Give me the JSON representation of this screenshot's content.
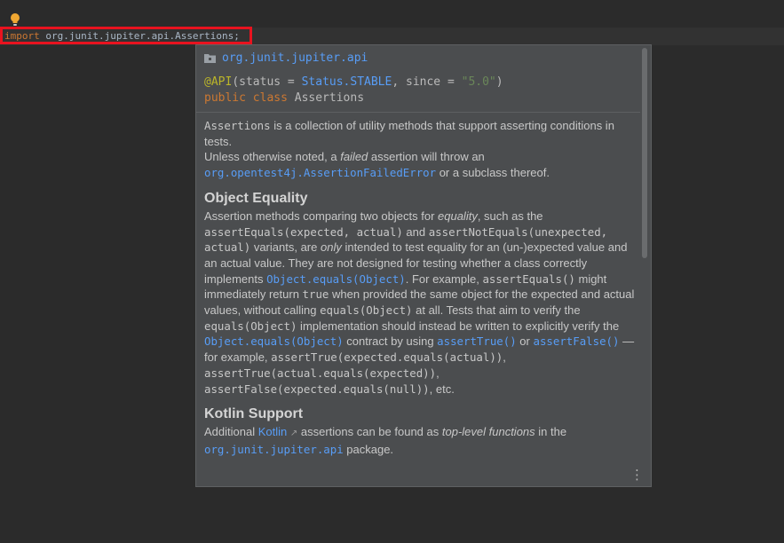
{
  "editor": {
    "import_keyword": "import",
    "import_path": " org.junit.jupiter.api.Assertions",
    "import_semicolon": ";"
  },
  "popup": {
    "package_link": "org.junit.jupiter.api",
    "signature": {
      "annotation": "@API",
      "args_open": "(status = ",
      "status_value": "Status.STABLE",
      "since_part": ", since = ",
      "since_value": "\"5.0\"",
      "args_close": ")",
      "modifiers": "public class ",
      "class_name": "Assertions"
    },
    "intro": {
      "class_code": "Assertions",
      "text1": " is a collection of utility methods that support asserting conditions in tests.",
      "text2": "Unless otherwise noted, a ",
      "failed": "failed",
      "text3": " assertion will throw an ",
      "error_link": "org.opentest4j.AssertionFailedError",
      "text4": " or a subclass thereof."
    },
    "equality": {
      "heading": "Object Equality",
      "t1": "Assertion methods comparing two objects for ",
      "equality": "equality",
      "t2": ", such as the ",
      "c1": "assertEquals(expected, actual)",
      "t3": " and ",
      "c2": "assertNotEquals(unexpected, actual)",
      "t4": " variants, are ",
      "only": "only",
      "t5": " intended to test equality for an (un-)expected value and an actual value. They are not designed for testing whether a class correctly implements ",
      "l1": "Object.equals(Object)",
      "t6": ". For example, ",
      "c3": "assertEquals()",
      "t7": " might immediately return ",
      "c4": "true",
      "t8": " when provided the same object for the expected and actual values, without calling ",
      "c5": "equals(Object)",
      "t9": " at all. Tests that aim to verify the ",
      "c6": "equals(Object)",
      "t10": " implementation should instead be written to explicitly verify the ",
      "l2": "Object.equals(Object)",
      "t11": " contract by using ",
      "l3": "assertTrue()",
      "t12": " or ",
      "l4": "assertFalse()",
      "t13": " — for example, ",
      "c7": "assertTrue(expected.equals(actual))",
      "t14": ", ",
      "c8": "assertTrue(actual.equals(expected))",
      "t15": ", ",
      "c9": "assertFalse(expected.equals(null))",
      "t16": ", etc."
    },
    "kotlin": {
      "heading": "Kotlin Support",
      "t1": "Additional ",
      "kotlin_link": "Kotlin",
      "ext": "↗",
      "t2": " assertions can be found as ",
      "top_level": "top-level functions",
      "t3": " in the ",
      "pkg_link": "org.junit.jupiter.api",
      "t4": " package."
    },
    "more_icon": "vertical-ellipsis",
    "colors": {
      "background": "#2b2b2b",
      "popup_bg": "#4b4d4f",
      "link": "#589df6",
      "keyword": "#cc7832",
      "highlight_box": "#e8131f"
    }
  }
}
